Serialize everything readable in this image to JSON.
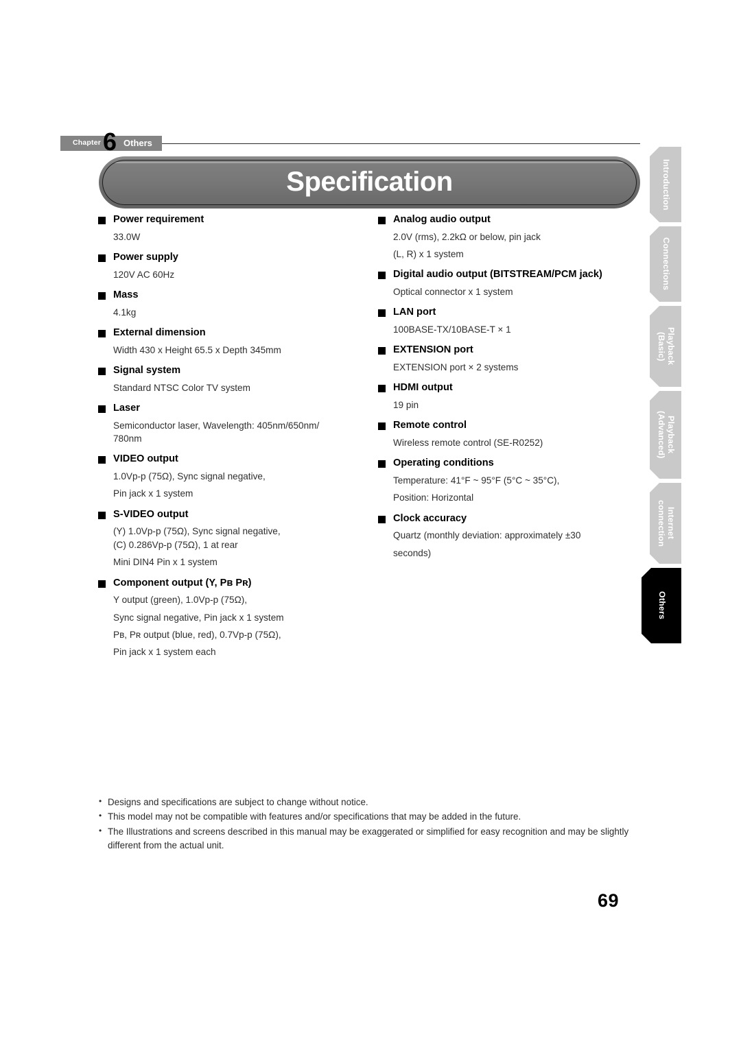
{
  "header": {
    "chapter_word": "Chapter",
    "chapter_number": "6",
    "chapter_name": "Others"
  },
  "title": "Specification",
  "page_number": "69",
  "tabs": [
    {
      "label": "Introduction",
      "active": false
    },
    {
      "label": "Connections",
      "active": false
    },
    {
      "label": "Playback\n(Basic)",
      "active": false
    },
    {
      "label": "Playback\n(Advanced)",
      "active": false
    },
    {
      "label": "Internet\nconnection",
      "active": false
    },
    {
      "label": "Others",
      "active": true
    }
  ],
  "left_column": [
    {
      "heading": "Power requirement",
      "lines": [
        {
          "text": "33.0W"
        }
      ]
    },
    {
      "heading": "Power supply",
      "lines": [
        {
          "text": "120V AC 60Hz"
        }
      ]
    },
    {
      "heading": "Mass",
      "lines": [
        {
          "text": "4.1kg"
        }
      ]
    },
    {
      "heading": "External dimension",
      "lines": [
        {
          "text": "Width 430 x Height 65.5 x Depth 345mm"
        }
      ]
    },
    {
      "heading": "Signal system",
      "lines": [
        {
          "text": "Standard NTSC Color TV system"
        }
      ]
    },
    {
      "heading": "Laser",
      "lines": [
        {
          "text": "Semiconductor laser, Wavelength: 405nm/650nm/"
        },
        {
          "text": "780nm",
          "tight": true
        }
      ]
    },
    {
      "heading": "VIDEO output",
      "lines": [
        {
          "text": "1.0Vp-p (75Ω), Sync signal negative,"
        },
        {
          "text": "Pin jack x 1 system"
        }
      ]
    },
    {
      "heading": "S-VIDEO output",
      "lines": [
        {
          "text": "(Y) 1.0Vp-p (75Ω), Sync signal negative,"
        },
        {
          "text": "(C) 0.286Vp-p (75Ω), 1 at rear",
          "tight": true
        },
        {
          "text": "Mini DIN4 Pin x 1 system"
        }
      ]
    },
    {
      "heading": "Component output (Y, Pʙ Pʀ)",
      "lines": [
        {
          "text": "Y output (green), 1.0Vp-p (75Ω),"
        },
        {
          "text": "Sync signal negative, Pin jack x 1 system"
        },
        {
          "text": "Pʙ, Pʀ output (blue, red), 0.7Vp-p (75Ω),"
        },
        {
          "text": "Pin jack x 1 system each"
        }
      ]
    }
  ],
  "right_column": [
    {
      "heading": "Analog audio output",
      "lines": [
        {
          "text": "2.0V (rms), 2.2kΩ or below, pin jack"
        },
        {
          "text": "(L, R) x 1 system"
        }
      ]
    },
    {
      "heading": "Digital audio output (BITSTREAM/PCM jack)",
      "lines": [
        {
          "text": "Optical connector x 1 system"
        }
      ]
    },
    {
      "heading": "LAN port",
      "lines": [
        {
          "text": "100BASE-TX/10BASE-T × 1"
        }
      ]
    },
    {
      "heading": "EXTENSION port",
      "lines": [
        {
          "text": "EXTENSION port × 2 systems"
        }
      ]
    },
    {
      "heading": "HDMI output",
      "lines": [
        {
          "text": "19 pin"
        }
      ]
    },
    {
      "heading": "Remote control",
      "lines": [
        {
          "text": "Wireless remote control (SE-R0252)"
        }
      ]
    },
    {
      "heading": "Operating conditions",
      "lines": [
        {
          "text": "Temperature: 41°F ~ 95°F (5°C ~ 35°C),"
        },
        {
          "text": "Position: Horizontal"
        }
      ]
    },
    {
      "heading": "Clock accuracy",
      "lines": [
        {
          "text": "Quartz (monthly deviation: approximately ±30"
        },
        {
          "text": "seconds)"
        }
      ]
    }
  ],
  "notes": [
    "Designs and specifications are subject to change without notice.",
    "This model may not be compatible with features and/or specifications that may be added in the future.",
    "The Illustrations and screens described in this manual may be exaggerated or simplified for easy recognition and may be slightly different from the actual unit."
  ]
}
